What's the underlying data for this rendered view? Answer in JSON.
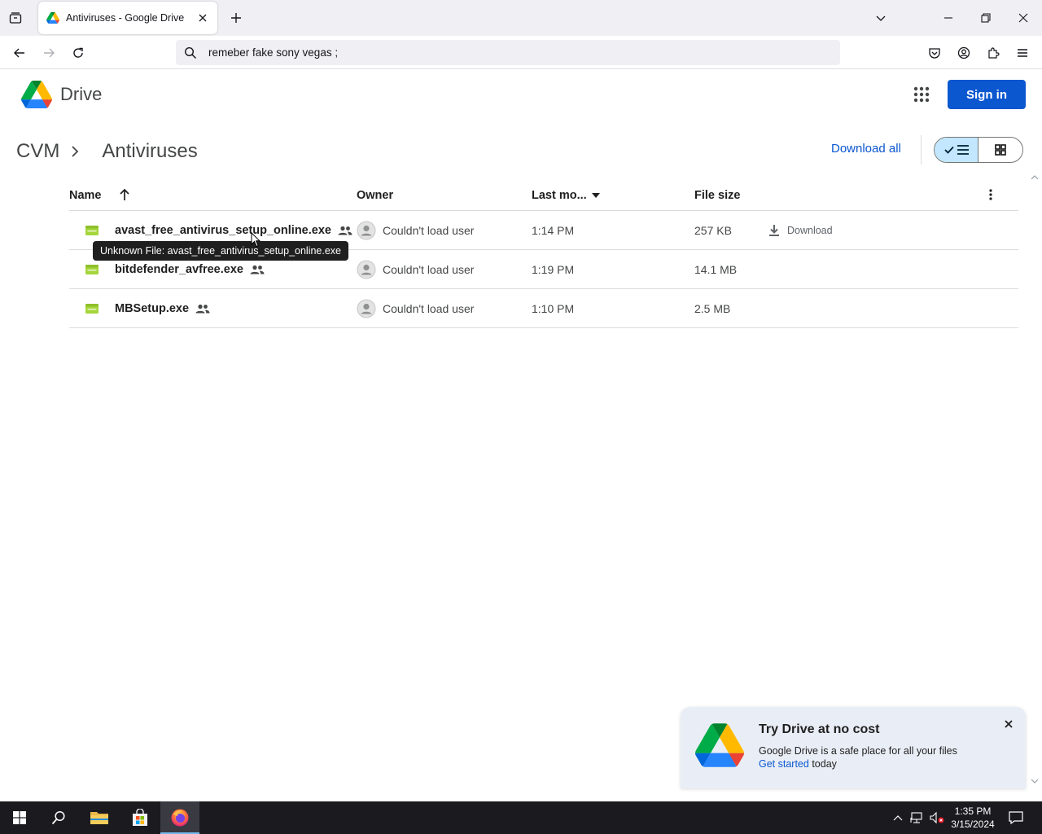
{
  "browser": {
    "tab_title": "Antiviruses - Google Drive",
    "url_text": "remeber fake sony vegas ;"
  },
  "drive": {
    "logo_text": "Drive",
    "sign_in_label": "Sign in",
    "breadcrumb": {
      "root": "CVM",
      "current": "Antiviruses"
    },
    "download_all_label": "Download all",
    "columns": {
      "name": "Name",
      "owner": "Owner",
      "modified": "Last mo...",
      "size": "File size"
    },
    "files": [
      {
        "name": "avast_free_antivirus_setup_online.exe",
        "owner": "Couldn't load user",
        "modified": "1:14 PM",
        "size": "257 KB",
        "action": "Download"
      },
      {
        "name": "bitdefender_avfree.exe",
        "owner": "Couldn't load user",
        "modified": "1:19 PM",
        "size": "14.1 MB"
      },
      {
        "name": "MBSetup.exe",
        "owner": "Couldn't load user",
        "modified": "1:10 PM",
        "size": "2.5 MB"
      }
    ],
    "tooltip": "Unknown File: avast_free_antivirus_setup_online.exe",
    "promo": {
      "title": "Try Drive at no cost",
      "text": "Google Drive is a safe place for all your files",
      "link": "Get started",
      "suffix": " today"
    }
  },
  "taskbar": {
    "time": "1:35 PM",
    "date": "3/15/2024"
  },
  "colors": {
    "accent": "#0b57d0",
    "file_icon": "#a5d63b",
    "view_selected": "#c2e7ff",
    "taskbar": "#1b1b1f"
  },
  "icons": [
    "tab-list-icon",
    "drive-favicon",
    "close-icon",
    "plus-icon",
    "chevron-down-icon",
    "minimize-icon",
    "restore-icon",
    "back-icon",
    "forward-icon",
    "reload-icon",
    "search-icon",
    "pocket-icon",
    "account-icon",
    "extensions-icon",
    "menu-icon",
    "apps-icon",
    "chevron-right-icon",
    "check-icon",
    "list-icon",
    "grid-icon",
    "arrow-up-icon",
    "more-vert-icon",
    "file-icon",
    "shared-icon",
    "avatar-icon",
    "download-icon",
    "windows-icon",
    "file-explorer-icon",
    "store-icon",
    "firefox-icon",
    "network-icon",
    "volume-muted-icon",
    "notification-icon"
  ]
}
